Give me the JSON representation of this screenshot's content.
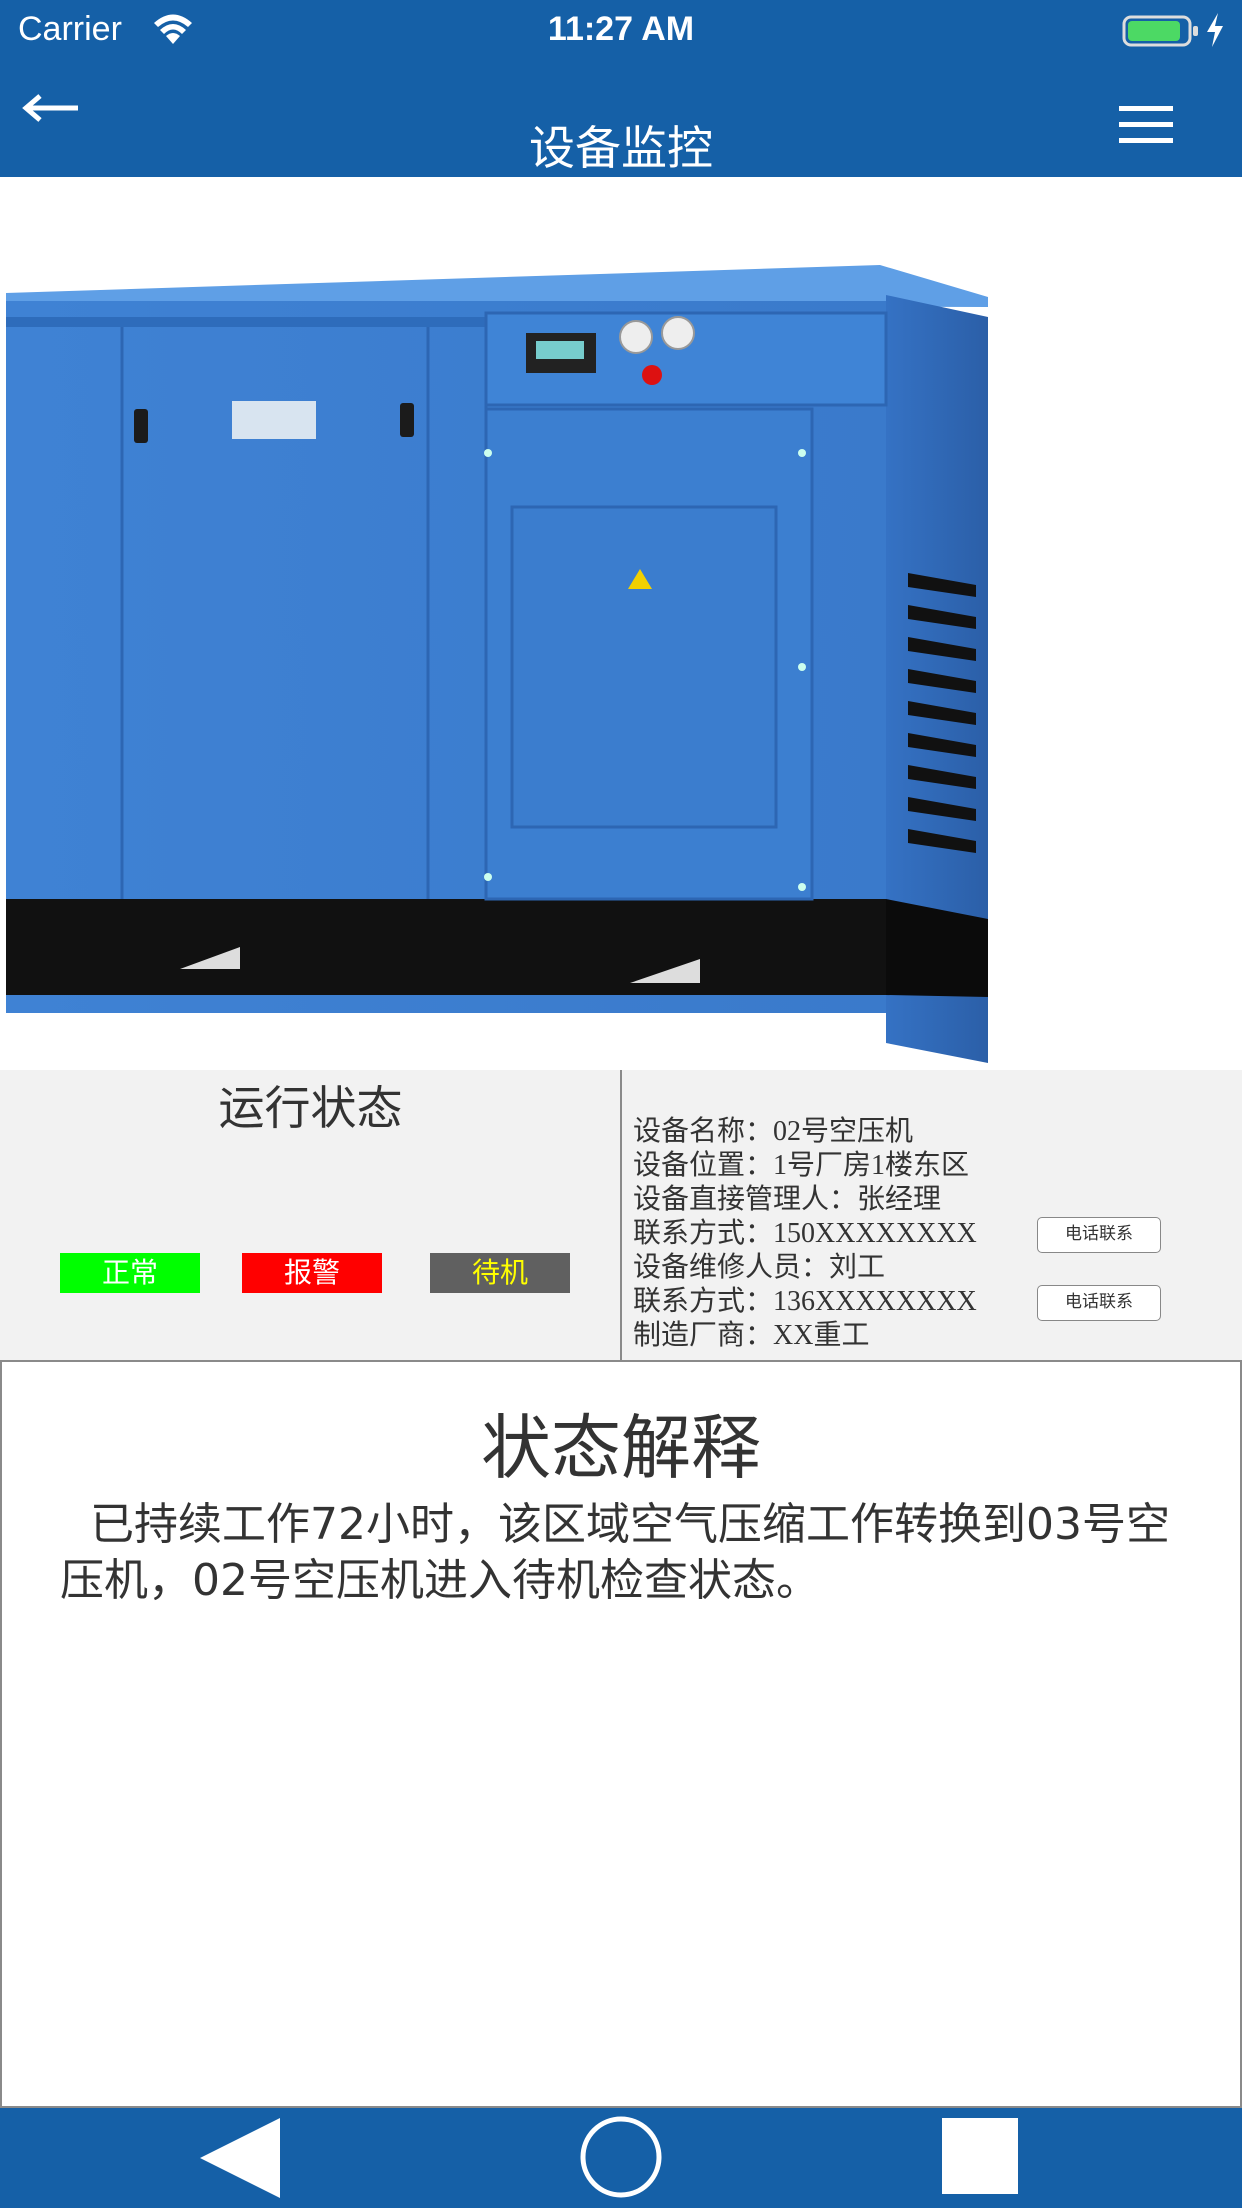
{
  "status_bar": {
    "carrier": "Carrier",
    "time": "11:27 AM"
  },
  "header": {
    "title": "设备监控",
    "back_icon": "arrow-left-icon",
    "menu_icon": "hamburger-menu-icon"
  },
  "product": {
    "image": "blue-air-compressor"
  },
  "run_status": {
    "title": "运行状态",
    "states": [
      {
        "label": "正常",
        "color": "#00ff00"
      },
      {
        "label": "报警",
        "color": "#ff0000"
      },
      {
        "label": "待机",
        "color": "#606060"
      }
    ]
  },
  "device_info": {
    "rows": [
      "设备名称：02号空压机",
      "设备位置：1号厂房1楼东区",
      "设备直接管理人：张经理",
      "联系方式：150XXXXXXXX",
      "设备维修人员：刘工",
      "联系方式：136XXXXXXXX",
      "制造厂商：XX重工"
    ],
    "call_button_label": "电话联系"
  },
  "explanation": {
    "title": "状态解释",
    "text": "已持续工作72小时，该区域空气压缩工作转换到03号空压机，02号空压机进入待机检查状态。"
  },
  "colors": {
    "brand_blue": "#1560a7",
    "panel_bg": "#f2f2f2"
  },
  "nav": {
    "back_icon": "triangle-back-icon",
    "home_icon": "circle-home-icon",
    "recents_icon": "square-recents-icon"
  }
}
